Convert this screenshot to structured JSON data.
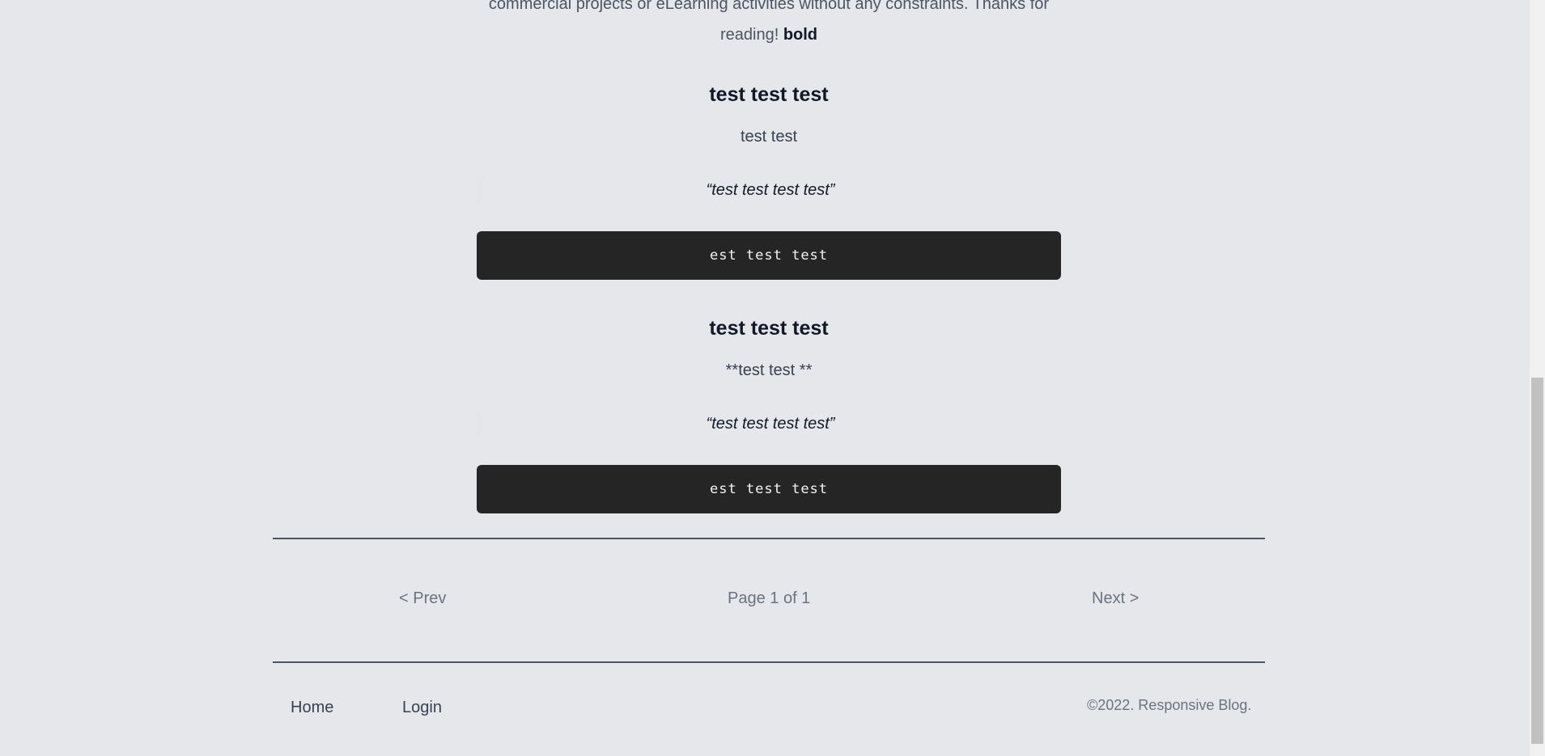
{
  "post": {
    "intro_line1": "commercial projects or eLearning activities without any constraints. Thanks for",
    "intro_line2_prefix": "reading! ",
    "intro_bold": "bold",
    "sections": [
      {
        "heading": "test test test",
        "paragraph": "test test",
        "quote": "“test test test test”",
        "code": "est test test"
      },
      {
        "heading": "test test test",
        "paragraph": "**test test **",
        "quote": "“test test test test”",
        "code": "est test test"
      }
    ]
  },
  "pagination": {
    "prev_label": "< Prev",
    "page_info": "Page 1 of 1",
    "next_label": "Next >"
  },
  "footer": {
    "home_label": "Home",
    "login_label": "Login",
    "copyright": "©2022. Responsive Blog."
  }
}
